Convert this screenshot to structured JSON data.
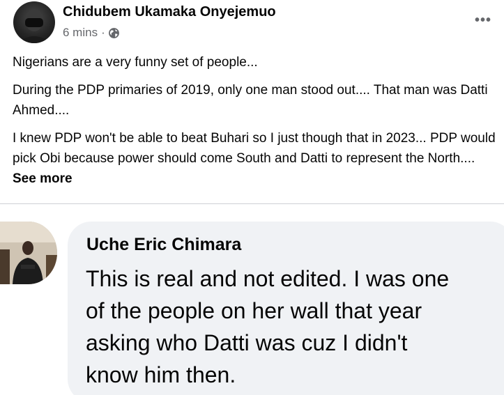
{
  "post": {
    "author": "Chidubem Ukamaka Onyejemuo",
    "time": "6 mins",
    "separator": "·",
    "privacy_icon": "globe-icon",
    "more_icon": "ellipsis-icon",
    "more_label": "•••",
    "paragraphs": [
      "Nigerians are a very funny set of people...",
      "During the PDP primaries of 2019, only one man stood out.... That man was Datti Ahmed....",
      "I knew PDP won't be able to beat  Buhari so I just though that in 2023... PDP would pick Obi because power should come South and Datti to represent the North.... "
    ],
    "see_more": "See more"
  },
  "comment": {
    "author": "Uche Eric Chimara",
    "lines": [
      "This is real and not edited. I was one",
      "of the people on her wall that year",
      "asking who Datti was cuz I didn't",
      "know him then."
    ]
  },
  "colors": {
    "text_primary": "#050505",
    "text_secondary": "#65676b",
    "bubble_bg": "#f0f2f5",
    "divider": "#ced0d4"
  }
}
